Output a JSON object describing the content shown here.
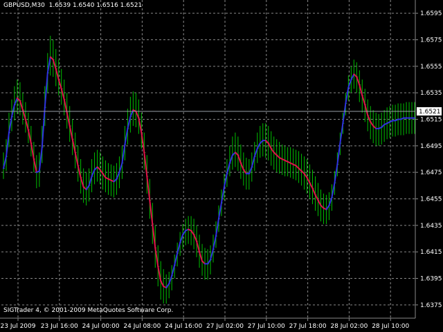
{
  "window": {
    "header": "GBPUSD,M30  1.6539 1.6540 1.6516 1.6521",
    "footer": "SIGTrader 4, © 2001-2009 MetaQuotes Software Corp."
  },
  "colors": {
    "background": "#000000",
    "grid": "#8a8a8a",
    "bars": "#00c000",
    "up_curve": "#3030e0",
    "down_curve": "#e0104a",
    "price_line": "#9aa0a8",
    "axis_text": "#ffffff"
  },
  "chart_data": {
    "type": "ohlc",
    "symbol": "GBPUSD",
    "timeframe": "M30",
    "current_price": 1.6521,
    "current_price_label": "1.6521",
    "ylim": [
      1.6365,
      1.6605
    ],
    "y_ticks": [
      "1.6595",
      "1.6575",
      "1.6555",
      "1.6535",
      "1.6515",
      "1.6495",
      "1.6475",
      "1.6455",
      "1.6435",
      "1.6415",
      "1.6395",
      "1.6375"
    ],
    "x_ticks": [
      "23 Jul 2009",
      "23 Jul 16:00",
      "24 Jul 00:00",
      "24 Jul 08:00",
      "24 Jul 16:00",
      "27 Jul 02:00",
      "27 Jul 10:00",
      "27 Jul 18:00",
      "28 Jul 02:00",
      "28 Jul 10:00"
    ],
    "bar_count": 150,
    "bars_high": [
      1.649,
      1.65,
      1.652,
      1.653,
      1.654,
      1.6545,
      1.6543,
      1.6535,
      1.6528,
      1.652,
      1.651,
      1.6498,
      1.6488,
      1.649,
      1.651,
      1.654,
      1.6565,
      1.6578,
      1.6575,
      1.6568,
      1.656,
      1.6553,
      1.6545,
      1.6535,
      1.6525,
      1.6515,
      1.6505,
      1.6495,
      1.6485,
      1.6478,
      1.6475,
      1.6478,
      1.6485,
      1.649,
      1.6492,
      1.649,
      1.6487,
      1.6484,
      1.6482,
      1.6481,
      1.648,
      1.6482,
      1.6487,
      1.6495,
      1.651,
      1.6523,
      1.6532,
      1.6536,
      1.6535,
      1.653,
      1.652,
      1.6505,
      1.6488,
      1.647,
      1.6452,
      1.6435,
      1.642,
      1.6408,
      1.6402,
      1.6398,
      1.64,
      1.6405,
      1.6413,
      1.6422,
      1.643,
      1.6436,
      1.644,
      1.6442,
      1.6442,
      1.644,
      1.6435,
      1.6428,
      1.6421,
      1.6418,
      1.6417,
      1.642,
      1.6428,
      1.6438,
      1.645,
      1.6462,
      1.6474,
      1.6485,
      1.6495,
      1.6502,
      1.6505,
      1.6502,
      1.6496,
      1.649,
      1.6486,
      1.6485,
      1.649,
      1.6498,
      1.6505,
      1.651,
      1.6512,
      1.6512,
      1.651,
      1.6506,
      1.6502,
      1.65,
      1.6498,
      1.6496,
      1.6495,
      1.6494,
      1.6494,
      1.6493,
      1.6492,
      1.6491,
      1.6489,
      1.6487,
      1.6485,
      1.6481,
      1.6477,
      1.6472,
      1.6467,
      1.6462,
      1.6459,
      1.6458,
      1.646,
      1.6466,
      1.6476,
      1.649,
      1.6505,
      1.652,
      1.6535,
      1.6548,
      1.6555,
      1.656,
      1.6558,
      1.6552,
      1.6545,
      1.6538,
      1.653,
      1.6525,
      1.6522,
      1.652,
      1.6519,
      1.652,
      1.6522,
      1.6524,
      1.6525,
      1.6526,
      1.6526,
      1.6527,
      1.6527,
      1.6527,
      1.6528,
      1.6528,
      1.6528,
      1.6528
    ],
    "bars_low": [
      1.647,
      1.6476,
      1.6494,
      1.6506,
      1.6514,
      1.6519,
      1.6518,
      1.6511,
      1.6505,
      1.6497,
      1.6487,
      1.6475,
      1.6463,
      1.6464,
      1.6482,
      1.651,
      1.6535,
      1.6548,
      1.6547,
      1.654,
      1.6533,
      1.6526,
      1.6518,
      1.6508,
      1.6498,
      1.6488,
      1.6478,
      1.6468,
      1.6459,
      1.6452,
      1.645,
      1.6453,
      1.646,
      1.6466,
      1.6468,
      1.6466,
      1.6462,
      1.646,
      1.6458,
      1.6457,
      1.6456,
      1.6458,
      1.6463,
      1.647,
      1.6484,
      1.6496,
      1.6505,
      1.651,
      1.6509,
      1.6504,
      1.6493,
      1.6477,
      1.6459,
      1.644,
      1.6421,
      1.6403,
      1.6389,
      1.6379,
      1.6376,
      1.6376,
      1.638,
      1.6386,
      1.6395,
      1.6404,
      1.6412,
      1.6417,
      1.642,
      1.6421,
      1.642,
      1.6417,
      1.6411,
      1.6403,
      1.6397,
      1.6394,
      1.6394,
      1.6398,
      1.6407,
      1.6418,
      1.643,
      1.6442,
      1.6454,
      1.6464,
      1.6472,
      1.6477,
      1.6479,
      1.6476,
      1.647,
      1.6465,
      1.6462,
      1.6462,
      1.6468,
      1.6476,
      1.6482,
      1.6486,
      1.6487,
      1.6486,
      1.6484,
      1.648,
      1.6477,
      1.6475,
      1.6474,
      1.6473,
      1.6472,
      1.6472,
      1.6471,
      1.647,
      1.6469,
      1.6467,
      1.6465,
      1.6462,
      1.6459,
      1.6455,
      1.6451,
      1.6446,
      1.6442,
      1.6438,
      1.6436,
      1.6436,
      1.6439,
      1.6446,
      1.6458,
      1.6472,
      1.6488,
      1.6504,
      1.6518,
      1.6529,
      1.6535,
      1.6538,
      1.6535,
      1.6528,
      1.652,
      1.6513,
      1.6506,
      1.65,
      1.6497,
      1.6495,
      1.6495,
      1.6496,
      1.6498,
      1.65,
      1.6501,
      1.6502,
      1.6502,
      1.6503,
      1.6503,
      1.6503,
      1.6504,
      1.6504,
      1.6504,
      1.6504
    ],
    "curve": [
      1.6478,
      1.6487,
      1.6505,
      1.6517,
      1.6526,
      1.6531,
      1.6529,
      1.6522,
      1.6515,
      1.6507,
      1.6497,
      1.6485,
      1.6475,
      1.6476,
      1.6494,
      1.6524,
      1.655,
      1.6562,
      1.656,
      1.6553,
      1.6545,
      1.6538,
      1.653,
      1.652,
      1.651,
      1.65,
      1.649,
      1.648,
      1.6471,
      1.6464,
      1.6462,
      1.6465,
      1.6472,
      1.6477,
      1.6479,
      1.6477,
      1.6474,
      1.6471,
      1.647,
      1.6469,
      1.6468,
      1.647,
      1.6475,
      1.6482,
      1.6496,
      1.6508,
      1.6517,
      1.6522,
      1.6521,
      1.6516,
      1.6505,
      1.649,
      1.6472,
      1.6454,
      1.6436,
      1.6418,
      1.6404,
      1.6393,
      1.6389,
      1.6388,
      1.6391,
      1.6397,
      1.6405,
      1.6414,
      1.6422,
      1.6428,
      1.6431,
      1.6432,
      1.6431,
      1.6428,
      1.6423,
      1.6415,
      1.6408,
      1.6406,
      1.6406,
      1.6409,
      1.6417,
      1.6427,
      1.644,
      1.6452,
      1.6464,
      1.6474,
      1.6482,
      1.6488,
      1.649,
      1.6488,
      1.6482,
      1.6477,
      1.6474,
      1.6474,
      1.6479,
      1.6487,
      1.6493,
      1.6497,
      1.6499,
      1.6499,
      1.6497,
      1.6493,
      1.649,
      1.6488,
      1.6486,
      1.6485,
      1.6484,
      1.6483,
      1.6482,
      1.6481,
      1.648,
      1.6478,
      1.6476,
      1.6474,
      1.6471,
      1.6467,
      1.6463,
      1.6458,
      1.6454,
      1.645,
      1.6448,
      1.6447,
      1.645,
      1.6456,
      1.6467,
      1.6481,
      1.6497,
      1.6512,
      1.6527,
      1.6539,
      1.6545,
      1.6549,
      1.6547,
      1.6541,
      1.6533,
      1.6526,
      1.6518,
      1.6513,
      1.651,
      1.6508,
      1.6508,
      1.6509,
      1.6511,
      1.6512,
      1.6513,
      1.6514,
      1.6514,
      1.6515,
      1.6515,
      1.6516,
      1.6516,
      1.6516,
      1.6516,
      1.6516
    ]
  }
}
